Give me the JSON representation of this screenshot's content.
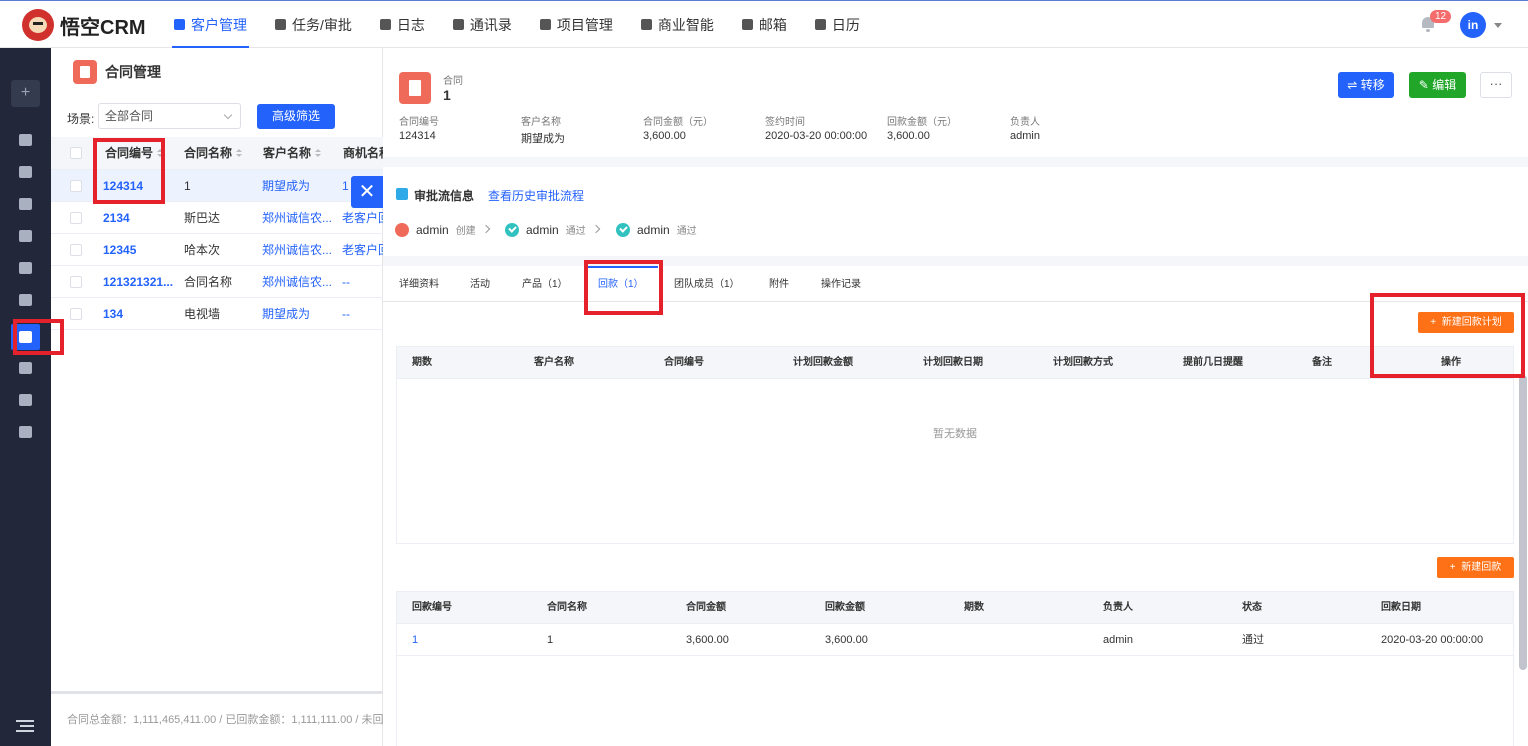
{
  "app": {
    "name": "悟空CRM"
  },
  "nav": {
    "items": [
      {
        "label": "客户管理",
        "active": true
      },
      {
        "label": "任务/审批",
        "active": false
      },
      {
        "label": "日志",
        "active": false
      },
      {
        "label": "通讯录",
        "active": false
      },
      {
        "label": "项目管理",
        "active": false
      },
      {
        "label": "商业智能",
        "active": false
      },
      {
        "label": "邮箱",
        "active": false
      },
      {
        "label": "日历",
        "active": false
      }
    ],
    "notification_count": "12",
    "avatar_text": "in"
  },
  "sidebar": {
    "add_label": "+",
    "icons": [
      "dashboard-icon",
      "chat-icon",
      "swap-icon",
      "building-icon",
      "contacts-icon",
      "money-icon",
      "contract-icon",
      "bag-icon",
      "box-icon",
      "send-icon"
    ],
    "active_index": 6
  },
  "list": {
    "title": "合同管理",
    "scene_label": "场景:",
    "scene_value": "全部合同",
    "advanced_filter": "高级筛选",
    "columns": [
      "合同编号",
      "合同名称",
      "客户名称",
      "商机名称"
    ],
    "rows": [
      {
        "code": "124314",
        "name": "1",
        "customer": "期望成为",
        "opportunity": "1",
        "selected": true
      },
      {
        "code": "2134",
        "name": "斯巴达",
        "customer": "郑州诚信农...",
        "opportunity": "老客户回",
        "selected": false
      },
      {
        "code": "12345",
        "name": "哈本次",
        "customer": "郑州诚信农...",
        "opportunity": "老客户回",
        "selected": false
      },
      {
        "code": "121321321...",
        "name": "合同名称",
        "customer": "郑州诚信农...",
        "opportunity": "--",
        "selected": false
      },
      {
        "code": "134",
        "name": "电视墙",
        "customer": "期望成为",
        "opportunity": "--",
        "selected": false
      }
    ],
    "footer": "合同总金额：1,111,465,411.00 / 已回款金额：1,111,111.00 / 未回"
  },
  "detail": {
    "type_label": "合同",
    "name": "1",
    "buttons": {
      "transfer": "转移",
      "edit": "编辑",
      "more": "···"
    },
    "fields": [
      {
        "label": "合同编号",
        "value": "124314"
      },
      {
        "label": "客户名称",
        "value": "期望成为"
      },
      {
        "label": "合同金额（元）",
        "value": "3,600.00"
      },
      {
        "label": "签约时间",
        "value": "2020-03-20 00:00:00"
      },
      {
        "label": "回款金额（元）",
        "value": "3,600.00"
      },
      {
        "label": "负责人",
        "value": "admin"
      }
    ],
    "approval": {
      "title": "审批流信息",
      "history_link": "查看历史审批流程",
      "steps": [
        {
          "user": "admin",
          "action": "创建",
          "status": "create"
        },
        {
          "user": "admin",
          "action": "通过",
          "status": "pass"
        },
        {
          "user": "admin",
          "action": "通过",
          "status": "pass"
        }
      ]
    },
    "tabs": [
      {
        "label": "详细资料"
      },
      {
        "label": "活动"
      },
      {
        "label": "产品（1）"
      },
      {
        "label": "回款（1）",
        "active": true
      },
      {
        "label": "团队成员（1）"
      },
      {
        "label": "附件"
      },
      {
        "label": "操作记录"
      }
    ],
    "plan": {
      "new_button": "新建回款计划",
      "columns": [
        "期数",
        "客户名称",
        "合同编号",
        "计划回款金额",
        "计划回款日期",
        "计划回款方式",
        "提前几日提醒",
        "备注",
        "操作"
      ],
      "empty_text": "暂无数据"
    },
    "receivables": {
      "new_button": "新建回款",
      "columns": [
        "回款编号",
        "合同名称",
        "合同金额",
        "回款金额",
        "期数",
        "负责人",
        "状态",
        "回款日期"
      ],
      "rows": [
        {
          "code": "1",
          "contract_name": "1",
          "contract_amount": "3,600.00",
          "amount": "3,600.00",
          "period": "",
          "owner": "admin",
          "status": "通过",
          "date": "2020-03-20 00:00:00"
        }
      ]
    }
  },
  "colors": {
    "primary": "#2362fb",
    "success": "#21a629",
    "warning": "#fe7116",
    "highlight": "#e5212b",
    "sidebar": "#22283a"
  }
}
